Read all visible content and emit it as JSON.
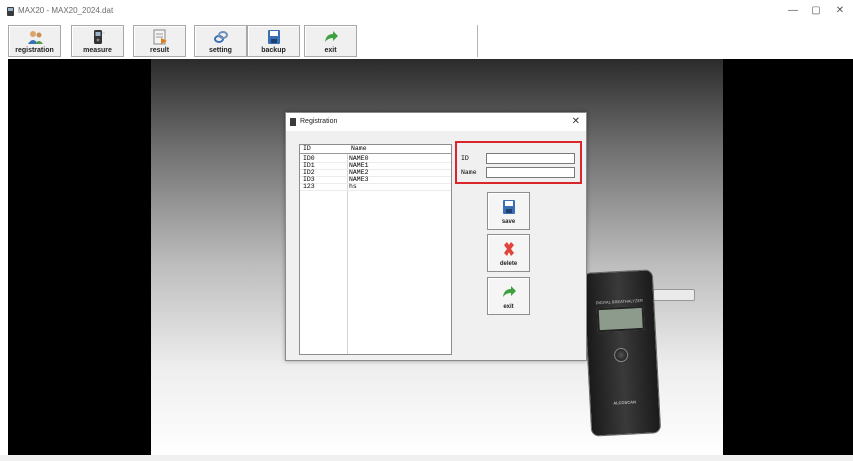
{
  "window": {
    "title": "MAX20 - MAX20_2024.dat",
    "minimize": "—",
    "maximize": "▢",
    "close": "✕"
  },
  "toolbar": {
    "buttons": [
      {
        "label": "registration",
        "icon": "registration-icon"
      },
      {
        "label": "measure",
        "icon": "measure-icon"
      },
      {
        "label": "result",
        "icon": "result-icon"
      },
      {
        "label": "setting",
        "icon": "setting-icon"
      },
      {
        "label": "backup",
        "icon": "backup-icon"
      },
      {
        "label": "exit",
        "icon": "exit-icon"
      }
    ]
  },
  "dialog": {
    "title": "Registration",
    "close": "✕",
    "list": {
      "headers": {
        "id": "ID",
        "name": "Name"
      },
      "rows": [
        {
          "id": "ID0",
          "name": "NAME0"
        },
        {
          "id": "ID1",
          "name": "NAME1"
        },
        {
          "id": "ID2",
          "name": "NAME2"
        },
        {
          "id": "ID3",
          "name": "NAME3"
        },
        {
          "id": "123",
          "name": "hs"
        }
      ]
    },
    "fields": {
      "id_label": "ID",
      "id_value": "",
      "name_label": "Name",
      "name_value": ""
    },
    "buttons": {
      "save": "save",
      "delete": "delete",
      "exit": "exit"
    }
  },
  "device": {
    "screen_text": "DIGITAL BREATHALYZER",
    "brand": "ALCOSCAN"
  },
  "colors": {
    "highlight": "#d9262c",
    "workspace": "#000000"
  }
}
